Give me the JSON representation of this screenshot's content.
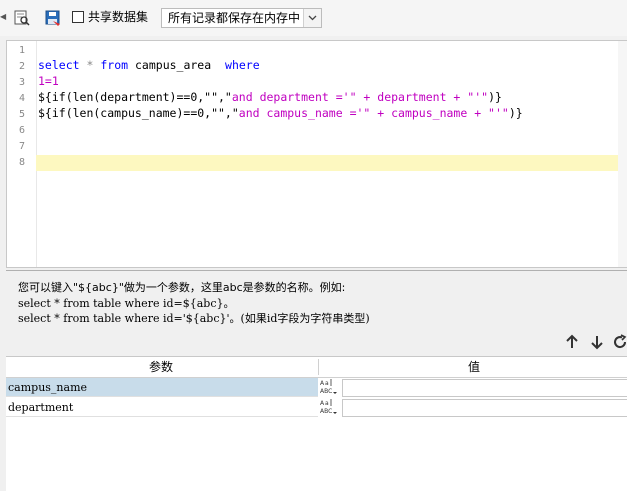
{
  "toolbar": {
    "share_label": "共享数据集",
    "share_checked": false,
    "storage_select_value": "所有记录都保存在内存中"
  },
  "editor": {
    "line_numbers": [
      "1",
      "2",
      "3",
      "4",
      "5",
      "6",
      "7",
      "8"
    ],
    "code": {
      "l2_select": "select",
      "l2_star": "*",
      "l2_from": "from",
      "l2_table": "campus_area",
      "l2_where": "where",
      "l3": "1=1",
      "l4_prefix": "${if(len(department)==0,\"\",\"",
      "l4_str": "and department ='\" + department + \"'\"",
      "l4_suffix": ")}",
      "l5_prefix": "${if(len(campus_name)==0,\"\",\"",
      "l5_str": "and campus_name ='\" + campus_name + \"'\"",
      "l5_suffix": ")}"
    },
    "highlight_line": 8
  },
  "help": {
    "line1": "您可以键入\"${abc}\"做为一个参数，这里abc是参数的名称。例如:",
    "line2": "select * from table where id=${abc}。",
    "line3": "select * from table where id='${abc}'。(如果id字段为字符串类型)"
  },
  "params": {
    "col_param": "参数",
    "col_value": "值",
    "rows": [
      {
        "name": "campus_name",
        "value": "",
        "selected": true
      },
      {
        "name": "department",
        "value": "",
        "selected": false
      }
    ],
    "type_icon": "abc-type-icon"
  },
  "colors": {
    "keyword": "#0000ff",
    "string": "#c000c0",
    "highlight_line": "#fdf8c0",
    "selected_row": "#c8dcea"
  }
}
